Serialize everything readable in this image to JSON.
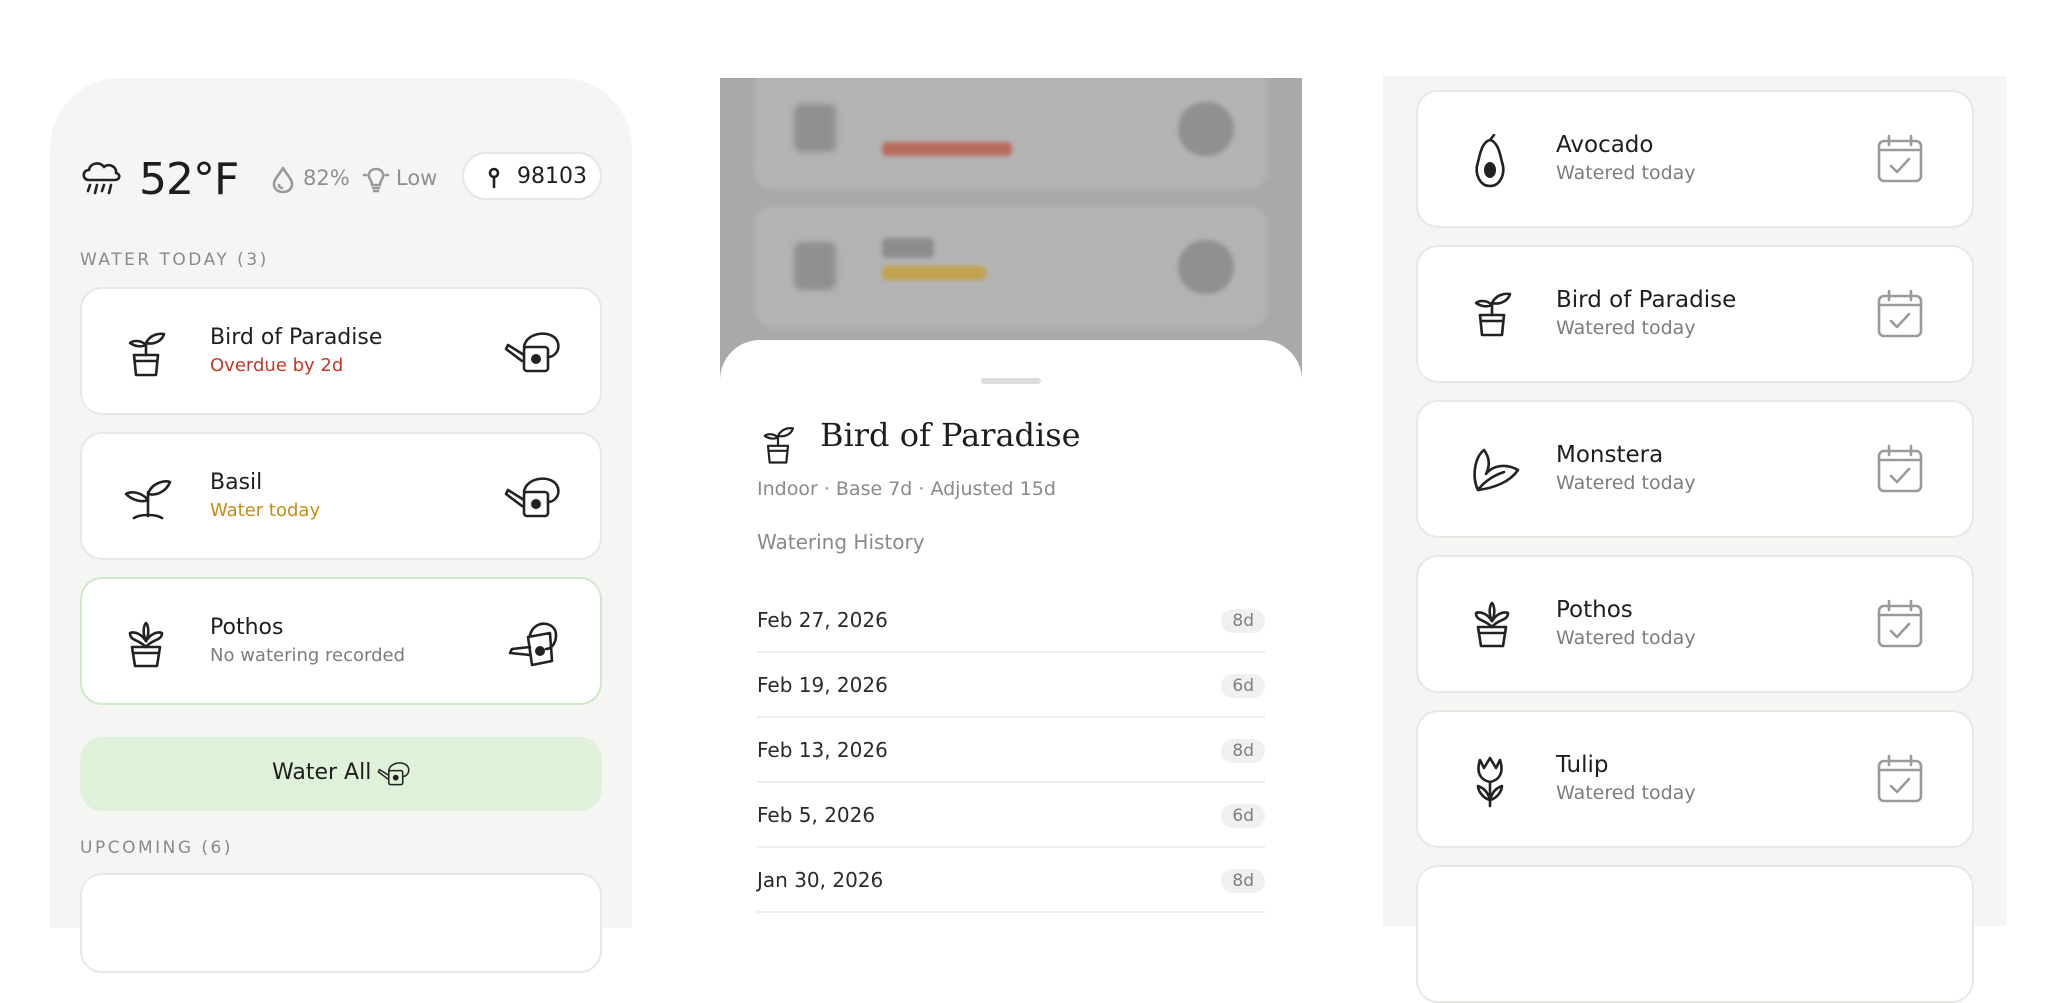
{
  "home": {
    "weather": {
      "temp": "52°F",
      "humidity": "82%",
      "uv": "Low",
      "zip": "98103"
    },
    "water_today_label": "WATER TODAY (3)",
    "water_today": [
      {
        "name": "Bird of Paradise",
        "status": "Overdue by 2d",
        "status_color": "#c0392b"
      },
      {
        "name": "Basil",
        "status": "Water today",
        "status_color": "#c98a14"
      },
      {
        "name": "Pothos",
        "status": "No watering recorded",
        "status_color": "#7d7d7d"
      }
    ],
    "water_all_label": "Water All",
    "upcoming_label": "UPCOMING (6)"
  },
  "detail": {
    "title": "Bird of Paradise",
    "meta": "Indoor · Base 7d · Adjusted 15d",
    "history_label": "Watering History",
    "history": [
      {
        "date": "Feb 27, 2026",
        "interval": "8d"
      },
      {
        "date": "Feb 19, 2026",
        "interval": "6d"
      },
      {
        "date": "Feb 13, 2026",
        "interval": "8d"
      },
      {
        "date": "Feb 5, 2026",
        "interval": "6d"
      },
      {
        "date": "Jan 30, 2026",
        "interval": "8d"
      }
    ]
  },
  "watered": {
    "items": [
      {
        "name": "Avocado",
        "status": "Watered today",
        "icon": "avocado-icon"
      },
      {
        "name": "Bird of Paradise",
        "status": "Watered today",
        "icon": "bird-of-paradise-icon"
      },
      {
        "name": "Monstera",
        "status": "Watered today",
        "icon": "monstera-leaf-icon"
      },
      {
        "name": "Pothos",
        "status": "Watered today",
        "icon": "pothos-icon"
      },
      {
        "name": "Tulip",
        "status": "Watered today",
        "icon": "tulip-icon"
      }
    ]
  },
  "colors": {
    "accent_green": "#dff2d9",
    "panel_bg": "#f5f5f3",
    "overdue": "#c0392b",
    "due": "#c98a14"
  }
}
